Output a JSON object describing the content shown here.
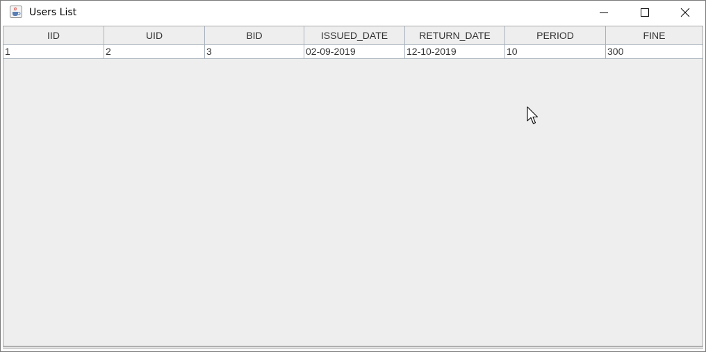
{
  "window": {
    "title": "Users List",
    "app_icon": "java-cup-icon",
    "controls": {
      "minimize_icon": "minimize-icon",
      "maximize_icon": "maximize-icon",
      "close_icon": "close-icon"
    }
  },
  "table": {
    "columns": [
      "IID",
      "UID",
      "BID",
      "ISSUED_DATE",
      "RETURN_DATE",
      "PERIOD",
      "FINE"
    ],
    "rows": [
      [
        "1",
        "2",
        "3",
        "02-09-2019",
        "12-10-2019",
        "10",
        "300"
      ]
    ]
  },
  "colors": {
    "client_background": "#eeeeee",
    "grid_line": "#a9b3bd",
    "text": "#333333"
  }
}
